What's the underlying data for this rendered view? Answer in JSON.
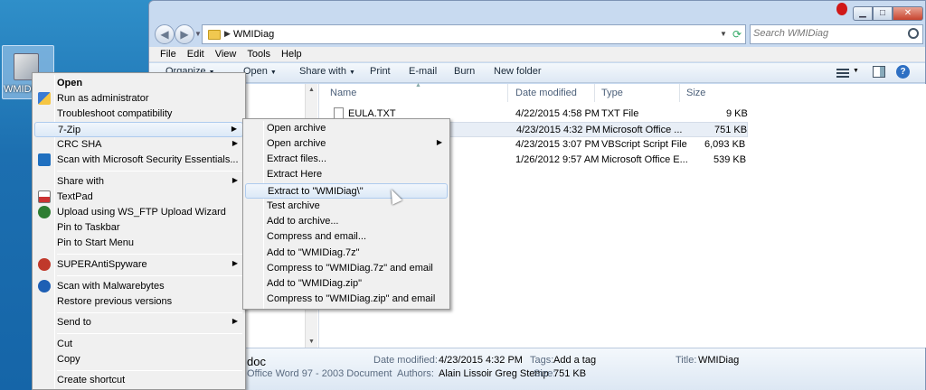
{
  "desktop": {
    "icon_label": "WMIDiag"
  },
  "window": {
    "address_path": "WMIDiag",
    "search_placeholder": "Search WMIDiag",
    "menu": [
      "File",
      "Edit",
      "View",
      "Tools",
      "Help"
    ],
    "toolbar": {
      "organize": "Organize",
      "open": "Open",
      "share": "Share with",
      "print": "Print",
      "email": "E-mail",
      "burn": "Burn",
      "new_folder": "New folder"
    },
    "columns": {
      "name": "Name",
      "date": "Date modified",
      "type": "Type",
      "size": "Size"
    },
    "files": [
      {
        "name": "EULA.TXT",
        "date": "4/22/2015 4:58 PM",
        "type": "TXT File",
        "size": "9 KB"
      },
      {
        "name": "",
        "date": "4/23/2015 4:32 PM",
        "type": "Microsoft Office ...",
        "size": "751 KB"
      },
      {
        "name": "",
        "date": "4/23/2015 3:07 PM",
        "type": "VBScript Script File",
        "size": "6,093 KB"
      },
      {
        "name": "",
        "date": "1/26/2012 9:57 AM",
        "type": "Microsoft Office E...",
        "size": "539 KB"
      }
    ],
    "details": {
      "filename": "doc",
      "filetype": "Office Word 97 - 2003 Document",
      "date_label": "Date modified:",
      "date_value": "4/23/2015 4:32 PM",
      "authors_label": "Authors:",
      "authors_value": "Alain Lissoir Greg Stemp",
      "tags_label": "Tags:",
      "tags_value": "Add a tag",
      "size_label": "Size:",
      "size_value": "751 KB",
      "title_label": "Title:",
      "title_value": "WMIDiag"
    }
  },
  "context_menu": {
    "items": [
      {
        "label": "Open"
      },
      {
        "label": "Run as administrator"
      },
      {
        "label": "Troubleshoot compatibility"
      },
      {
        "label": "7-Zip"
      },
      {
        "label": "CRC SHA"
      },
      {
        "label": "Scan with Microsoft Security Essentials..."
      },
      {
        "label": "Share with"
      },
      {
        "label": "TextPad"
      },
      {
        "label": "Upload using WS_FTP Upload Wizard"
      },
      {
        "label": "Pin to Taskbar"
      },
      {
        "label": "Pin to Start Menu"
      },
      {
        "label": "SUPERAntiSpyware"
      },
      {
        "label": "Scan with Malwarebytes"
      },
      {
        "label": "Restore previous versions"
      },
      {
        "label": "Send to"
      },
      {
        "label": "Cut"
      },
      {
        "label": "Copy"
      },
      {
        "label": "Create shortcut"
      }
    ]
  },
  "zip_submenu": {
    "items": [
      {
        "label": "Open archive"
      },
      {
        "label": "Open archive"
      },
      {
        "label": "Extract files..."
      },
      {
        "label": "Extract Here"
      },
      {
        "label": "Extract to \"WMIDiag\\\""
      },
      {
        "label": "Test archive"
      },
      {
        "label": "Add to archive..."
      },
      {
        "label": "Compress and email..."
      },
      {
        "label": "Add to \"WMIDiag.7z\""
      },
      {
        "label": "Compress to \"WMIDiag.7z\" and email"
      },
      {
        "label": "Add to \"WMIDiag.zip\""
      },
      {
        "label": "Compress to \"WMIDiag.zip\" and email"
      }
    ]
  }
}
